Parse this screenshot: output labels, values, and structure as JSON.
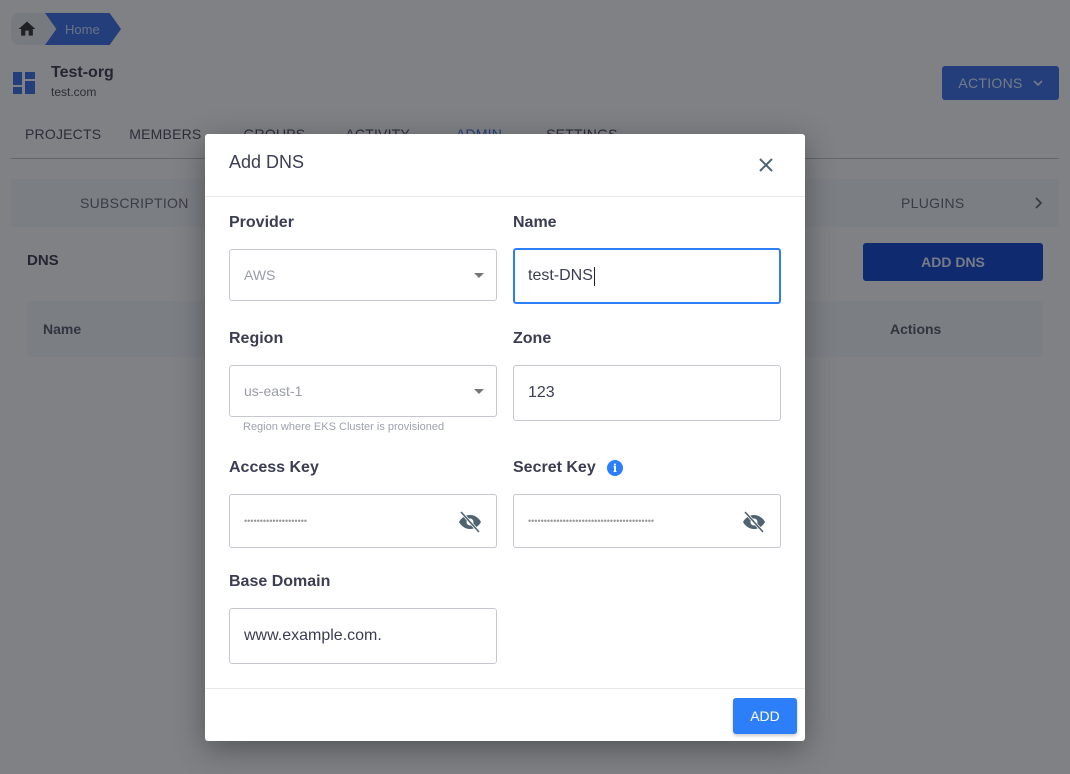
{
  "breadcrumb": {
    "home_icon": "home-icon",
    "items": [
      "Home"
    ]
  },
  "org": {
    "icon": "dashboard-icon",
    "name": "Test-org",
    "domain": "test.com"
  },
  "header": {
    "actions_label": "ACTIONS"
  },
  "main_tabs": [
    {
      "label": "PROJECTS",
      "active": false
    },
    {
      "label": "MEMBERS",
      "active": false
    },
    {
      "label": "GROUPS",
      "active": false
    },
    {
      "label": "ACTIVITY",
      "active": false
    },
    {
      "label": "ADMIN",
      "active": true
    },
    {
      "label": "SETTINGS",
      "active": false
    }
  ],
  "sub_tabs": {
    "first": "SUBSCRIPTION",
    "last": "PLUGINS"
  },
  "dns_section": {
    "title": "DNS",
    "add_button": "ADD DNS",
    "table_headers": [
      "Name",
      "Actions"
    ]
  },
  "modal": {
    "title": "Add DNS",
    "fields": {
      "provider": {
        "label": "Provider",
        "value": "AWS"
      },
      "name": {
        "label": "Name",
        "value": "test-DNS"
      },
      "region": {
        "label": "Region",
        "value": "us-east-1",
        "helper": "Region where EKS Cluster is provisioned"
      },
      "zone": {
        "label": "Zone",
        "value": "123"
      },
      "access_key": {
        "label": "Access Key",
        "masked": "••••••••••••••••••••"
      },
      "secret_key": {
        "label": "Secret Key",
        "masked": "••••••••••••••••••••••••••••••••••••••••"
      },
      "base_domain": {
        "label": "Base Domain",
        "value": "www.example.com."
      }
    },
    "info_glyph": "i",
    "submit_label": "ADD"
  },
  "colors": {
    "primary": "#2d7ff9",
    "brand": "#2a63e0",
    "add_dns": "#0036c8"
  }
}
